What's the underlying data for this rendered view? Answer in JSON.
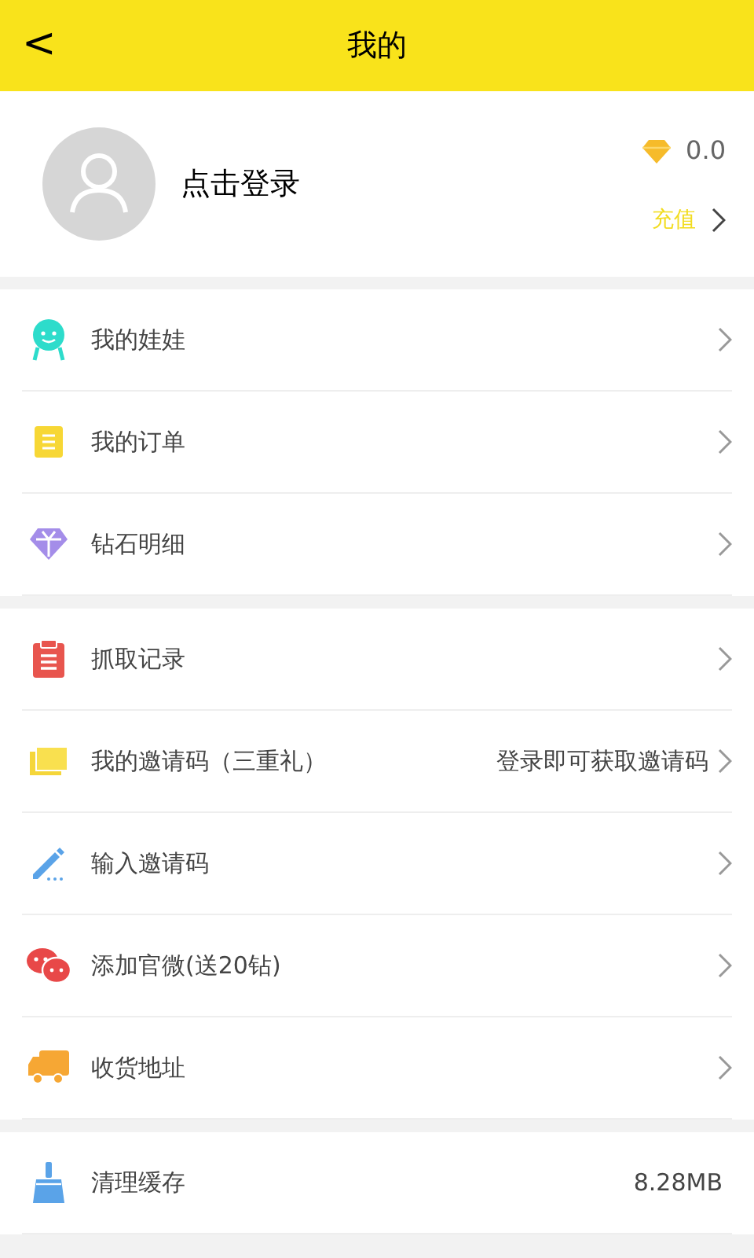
{
  "header": {
    "back": "<",
    "title": "我的"
  },
  "profile": {
    "login": "点击登录",
    "diamonds": "0.0",
    "recharge": "充值"
  },
  "groups": [
    {
      "items": [
        {
          "kind": "link",
          "label": "我的娃娃"
        },
        {
          "kind": "link",
          "label": "我的订单"
        },
        {
          "kind": "link",
          "label": "钻石明细"
        }
      ]
    },
    {
      "items": [
        {
          "kind": "link",
          "label": "抓取记录"
        },
        {
          "kind": "link",
          "label": "我的邀请码（三重礼）",
          "value": "登录即可获取邀请码"
        },
        {
          "kind": "link",
          "label": "输入邀请码"
        },
        {
          "kind": "link",
          "label": "添加官微(送20钻)"
        },
        {
          "kind": "link",
          "label": "收货地址"
        }
      ]
    },
    {
      "items": [
        {
          "kind": "value",
          "label": "清理缓存",
          "value": "8.28MB"
        }
      ]
    }
  ]
}
